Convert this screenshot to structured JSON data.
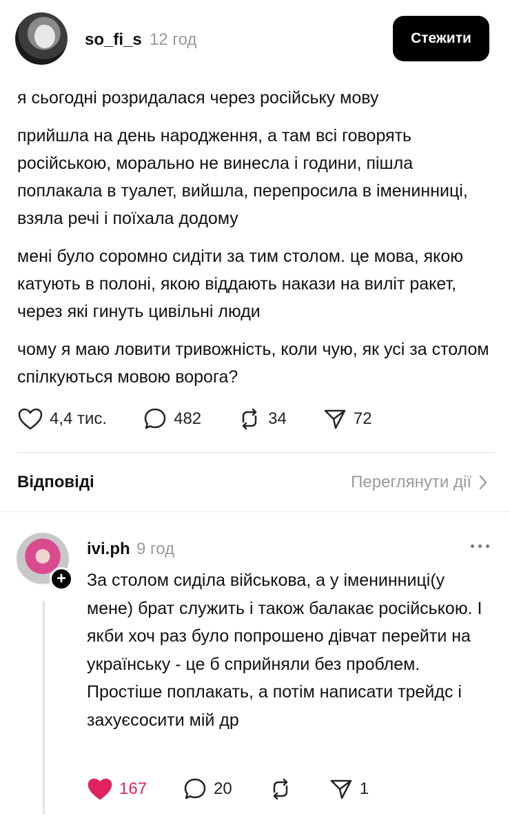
{
  "post": {
    "username": "so_fi_s",
    "time": "12 год",
    "follow_label": "Стежити",
    "paragraphs": [
      "я сьогодні розридалася через російську мову",
      "прийшла на день народження, а там всі говорять російською, морально не винесла і години, пішла поплакала в туалет, вийшла, перепросила в іменинниці, взяла речі і поїхала додому",
      "мені було соромно сидіти за тим столом. це мова, якою катують в полоні, якою віддають накази на виліт ракет, через які гинуть цивільні люди",
      "чому я маю ловити тривожність, коли чую, як усі за столом спілкуються мовою ворога?"
    ],
    "likes": "4,4 тис.",
    "comments": "482",
    "reposts": "34",
    "shares": "72"
  },
  "replies_section": {
    "title": "Відповіді",
    "view_activity": "Переглянути дії"
  },
  "reply": {
    "username": "ivi.ph",
    "time": "9 год",
    "text": "За столом сиділа військова, а у іменинниці(у мене) брат служить і також балакає російською. І якби хоч раз було попрошено дівчат перейти на українську - це б сприйняли без проблем. Простіше поплакать, а потім написати трейдс і захуєсосити мій др",
    "likes": "167",
    "comments": "20",
    "shares": "1",
    "liked": true
  },
  "colors": {
    "like_active": "#e0245e",
    "muted_text": "#9a9a9a",
    "follow_button_bg": "#000000"
  },
  "icons": [
    "heart-icon",
    "comment-icon",
    "repost-icon",
    "share-icon",
    "chevron-right-icon",
    "more-icon",
    "plus-icon"
  ]
}
